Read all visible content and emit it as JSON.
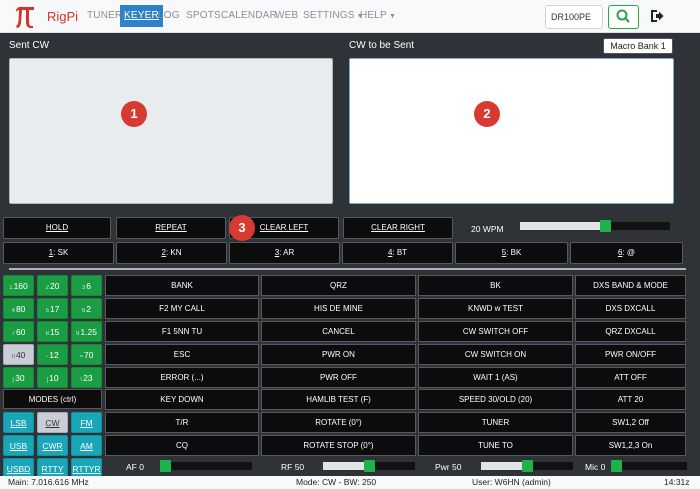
{
  "nav": {
    "brand": "RigPi",
    "items": [
      {
        "label": "TUNER"
      },
      {
        "label": "KEYER"
      },
      {
        "label": "LOG"
      },
      {
        "label": "SPOTS"
      },
      {
        "label": "CALENDAR"
      },
      {
        "label": "WEB"
      },
      {
        "label": "SETTINGS"
      },
      {
        "label": "HELP"
      }
    ],
    "callsign_value": "DR100PE"
  },
  "panes": {
    "sent_title": "Sent CW",
    "tobesent_title": "CW to be Sent",
    "macro_bank": "Macro Bank 1",
    "badge1": "1",
    "badge2": "2",
    "badge3": "3"
  },
  "controls": {
    "hold": "HOLD",
    "repeat": "REPEAT",
    "clear_left": "CLEAR LEFT",
    "clear_right": "CLEAR RIGHT",
    "wpm": "20 WPM",
    "wpm_level": 0.57
  },
  "quick": [
    {
      "num": "1",
      "text": ": SK"
    },
    {
      "num": "2",
      "text": ": KN"
    },
    {
      "num": "3",
      "text": ": AR"
    },
    {
      "num": "4",
      "text": ": BT"
    },
    {
      "num": "5",
      "text": ": BK"
    },
    {
      "num": "6",
      "text": ": @"
    }
  ],
  "bands": [
    {
      "pre": "1",
      "label": "160"
    },
    {
      "pre": "2",
      "label": "20"
    },
    {
      "pre": "3",
      "label": "6"
    },
    {
      "pre": "4",
      "label": "80"
    },
    {
      "pre": "5",
      "label": "17"
    },
    {
      "pre": "6",
      "label": "2"
    },
    {
      "pre": "7",
      "label": "60"
    },
    {
      "pre": "8",
      "label": "15"
    },
    {
      "pre": "9",
      "label": "1.25"
    },
    {
      "pre": "0",
      "label": "40"
    },
    {
      "pre": "-",
      "label": "12"
    },
    {
      "pre": "=",
      "label": "70"
    },
    {
      "pre": "[",
      "label": "30"
    },
    {
      "pre": "]",
      "label": "10"
    },
    {
      "pre": "\\",
      "label": "23"
    }
  ],
  "modes_label": "MODES (ctrl)",
  "modes": [
    "LSB",
    "CW",
    "FM",
    "USB",
    "CWR",
    "AM",
    "USBD",
    "RTTY",
    "RTTYR"
  ],
  "macros": [
    [
      "BANK",
      "QRZ",
      "BK",
      "DXS BAND & MODE"
    ],
    [
      "F2 MY CALL",
      "HIS DE MINE",
      "KNWD w TEST",
      "DXS DXCALL"
    ],
    [
      "F1 5NN TU",
      "CANCEL",
      "CW SWITCH OFF",
      "QRZ DXCALL"
    ],
    [
      "ESC",
      "PWR ON",
      "CW SWITCH ON",
      "PWR ON/OFF"
    ],
    [
      "ERROR (...)",
      "PWR OFF",
      "WAIT 1 (AS)",
      "ATT OFF"
    ],
    [
      "KEY DOWN",
      "HAMLIB TEST (F)",
      "SPEED 30/OLD (20)",
      "ATT 20"
    ],
    [
      "T/R",
      "ROTATE (0°)",
      "TUNER",
      "SW1,2 Off"
    ],
    [
      "CQ",
      "ROTATE STOP (0°)",
      "TUNE TO",
      "SW1,2,3 On"
    ]
  ],
  "levels": {
    "af": "AF  0",
    "af_value": 0,
    "rf": "RF  50",
    "rf_value": 50,
    "pwr": "Pwr  50",
    "pwr_value": 50,
    "mic": "Mic  0",
    "mic_value": 0
  },
  "status": {
    "main": "Main: 7.016.616 MHz",
    "mode": "Mode: CW - BW: 250",
    "user": "User: W6HN (admin)",
    "time": "14:31z"
  },
  "colors": {
    "accent": "#2f82c9",
    "band_green": "#1b9e43",
    "mode_teal": "#19a6b9",
    "badge_red": "#d73a31"
  }
}
